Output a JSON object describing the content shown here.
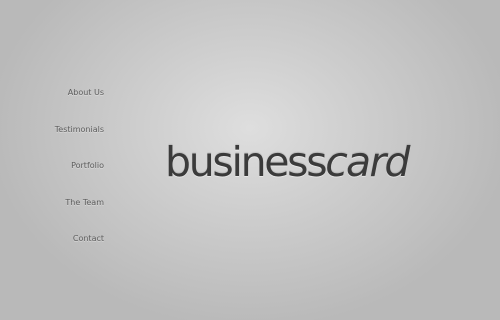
{
  "nav": {
    "items": [
      {
        "label": "About Us"
      },
      {
        "label": "Testimonials"
      },
      {
        "label": "Portfolio"
      },
      {
        "label": "The Team"
      },
      {
        "label": "Contact"
      }
    ]
  },
  "logo": {
    "part1": "business",
    "part2": "card"
  },
  "colors": {
    "background_center": "#dedede",
    "background_edge": "#b9b9b9",
    "logo_text": "#3b3b3b",
    "nav_text": "#5d5d5d"
  }
}
